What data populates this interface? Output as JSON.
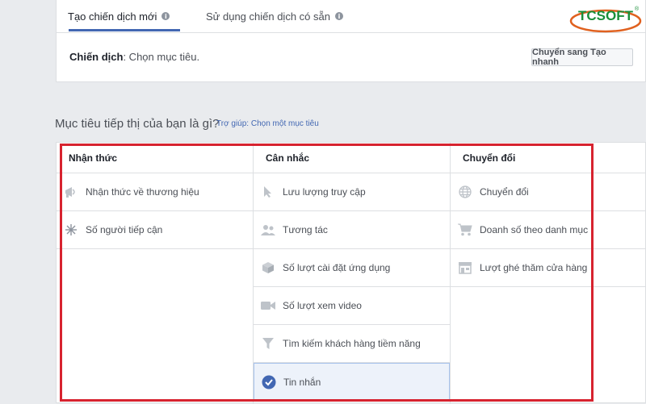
{
  "tabs": [
    {
      "label": "Tạo chiến dịch mới",
      "info": "i"
    },
    {
      "label": "Sử dụng chiến dịch có sẵn",
      "info": "i"
    }
  ],
  "campaign": {
    "label": "Chiến dịch",
    "value": ": Chọn mục tiêu."
  },
  "quick_button": "Chuyển sang Tạo nhanh",
  "logo_text": "TCSOFT",
  "logo_mark": "®",
  "question": "Mục tiêu tiếp thị của bạn là gì?",
  "help_link": "Trợ giúp: Chọn một mục tiêu",
  "columns": [
    {
      "header": "Nhận thức",
      "items": [
        {
          "label": "Nhận thức về thương hiệu",
          "icon": "megaphone-icon"
        },
        {
          "label": "Số người tiếp cận",
          "icon": "snowflake-icon"
        }
      ]
    },
    {
      "header": "Cân nhắc",
      "items": [
        {
          "label": "Lưu lượng truy cập",
          "icon": "cursor-icon"
        },
        {
          "label": "Tương tác",
          "icon": "people-icon"
        },
        {
          "label": "Số lượt cài đặt ứng dụng",
          "icon": "box-icon"
        },
        {
          "label": "Số lượt xem video",
          "icon": "video-camera-icon"
        },
        {
          "label": "Tìm kiếm khách hàng tiềm năng",
          "icon": "funnel-icon"
        },
        {
          "label": "Tin nhắn",
          "icon": "check-circle-icon"
        }
      ]
    },
    {
      "header": "Chuyển đổi",
      "items": [
        {
          "label": "Chuyển đổi",
          "icon": "globe-icon"
        },
        {
          "label": "Doanh số theo danh mục",
          "icon": "cart-icon"
        },
        {
          "label": "Lượt ghé thăm cửa hàng",
          "icon": "store-icon"
        }
      ]
    }
  ],
  "colors": {
    "accent": "#4267b2",
    "highlight": "#d7232f",
    "selected_bg": "#edf2fa",
    "logo": "#1a8f3a"
  }
}
